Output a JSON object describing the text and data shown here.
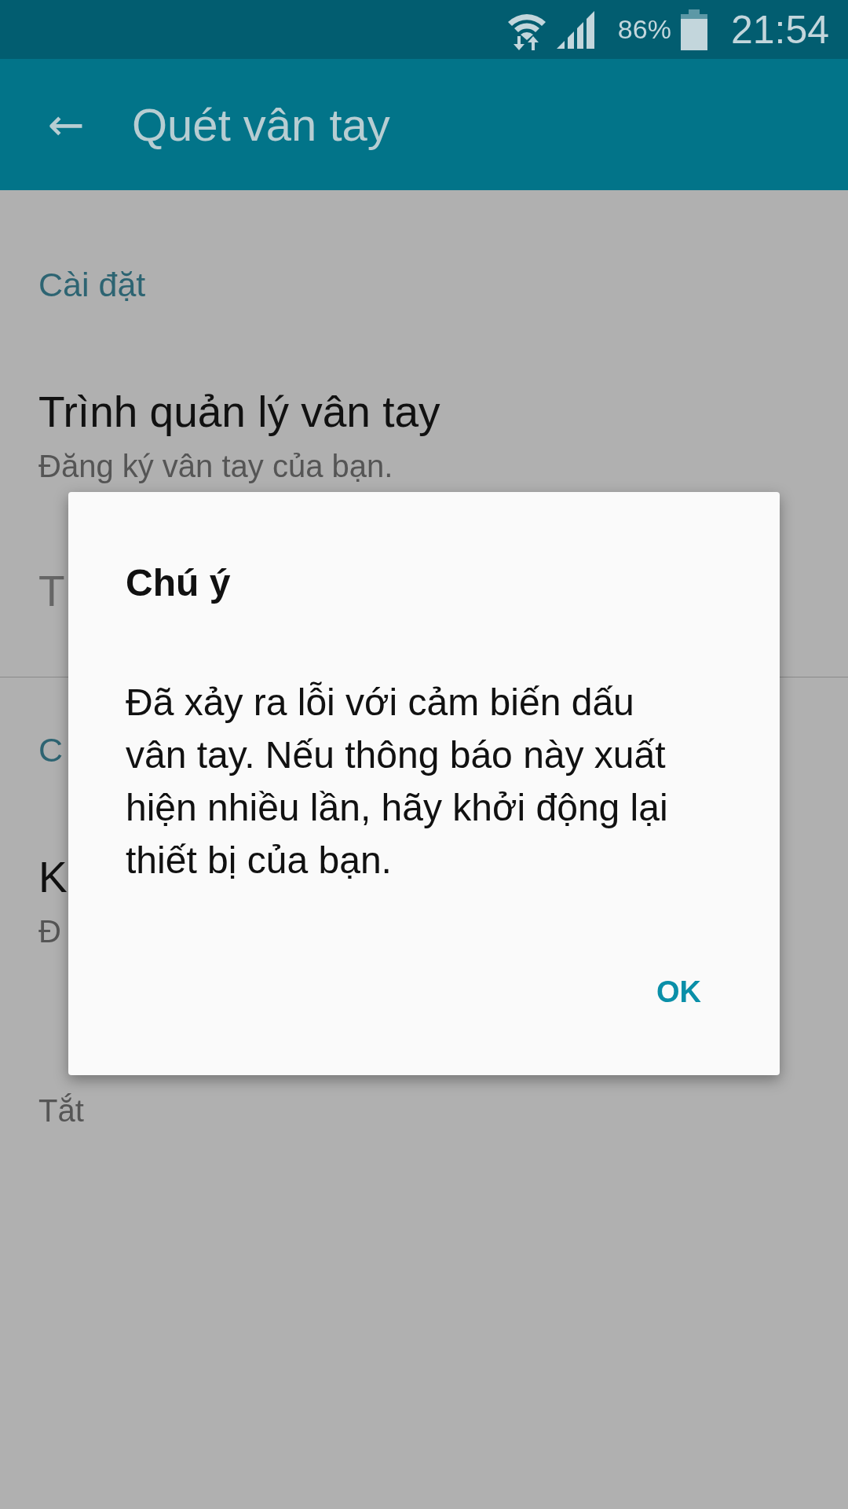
{
  "status_bar": {
    "battery": "86%",
    "time": "21:54"
  },
  "app_bar": {
    "back": "←",
    "title": "Quét vân tay"
  },
  "settings": [
    {
      "kind": "header",
      "title": "Cài đặt"
    },
    {
      "kind": "item",
      "title": "Trình quản lý vân tay",
      "subtitle": "Đăng ký vân tay của bạn.",
      "disabled": false
    },
    {
      "kind": "item",
      "title": "T",
      "disabled": true
    },
    {
      "kind": "divider"
    },
    {
      "kind": "header",
      "title": "C"
    },
    {
      "kind": "item",
      "title": "K",
      "subtitle": "Đ",
      "disabled": false
    },
    {
      "kind": "item",
      "subtitle": "Tắt",
      "disabled": false
    }
  ],
  "dialog": {
    "title": "Chú ý",
    "message": "Đã xảy ra lỗi với cảm biến dấu vân tay. Nếu thông báo này xuất hiện nhiều lần, hãy khởi động lại thiết bị của bạn.",
    "buttons": [
      "OK"
    ]
  }
}
